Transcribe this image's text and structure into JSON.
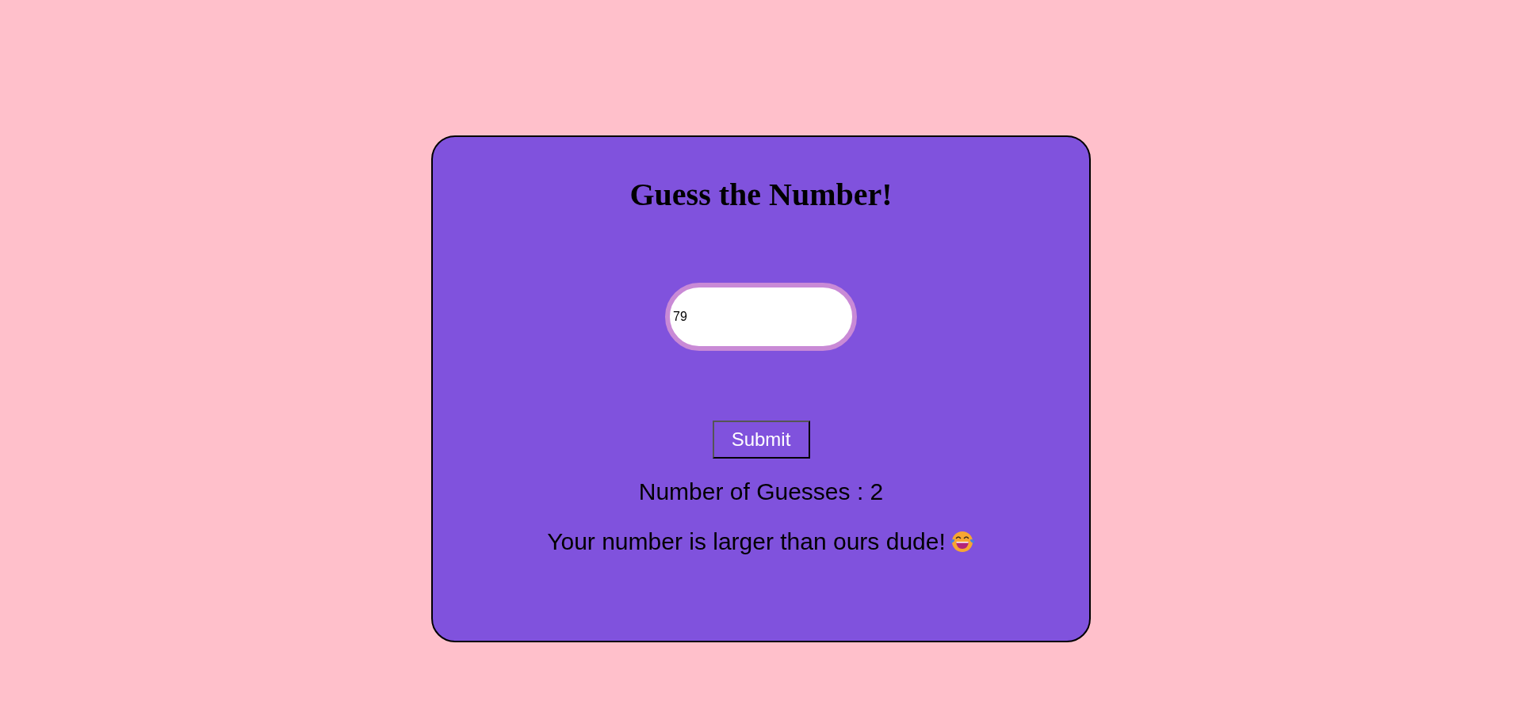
{
  "title": "Guess the Number!",
  "guess_input": {
    "value": "79"
  },
  "submit_button": {
    "label": "Submit"
  },
  "guess_count": "Number of Guesses : 2",
  "message": "Your number is larger than ours dude!"
}
